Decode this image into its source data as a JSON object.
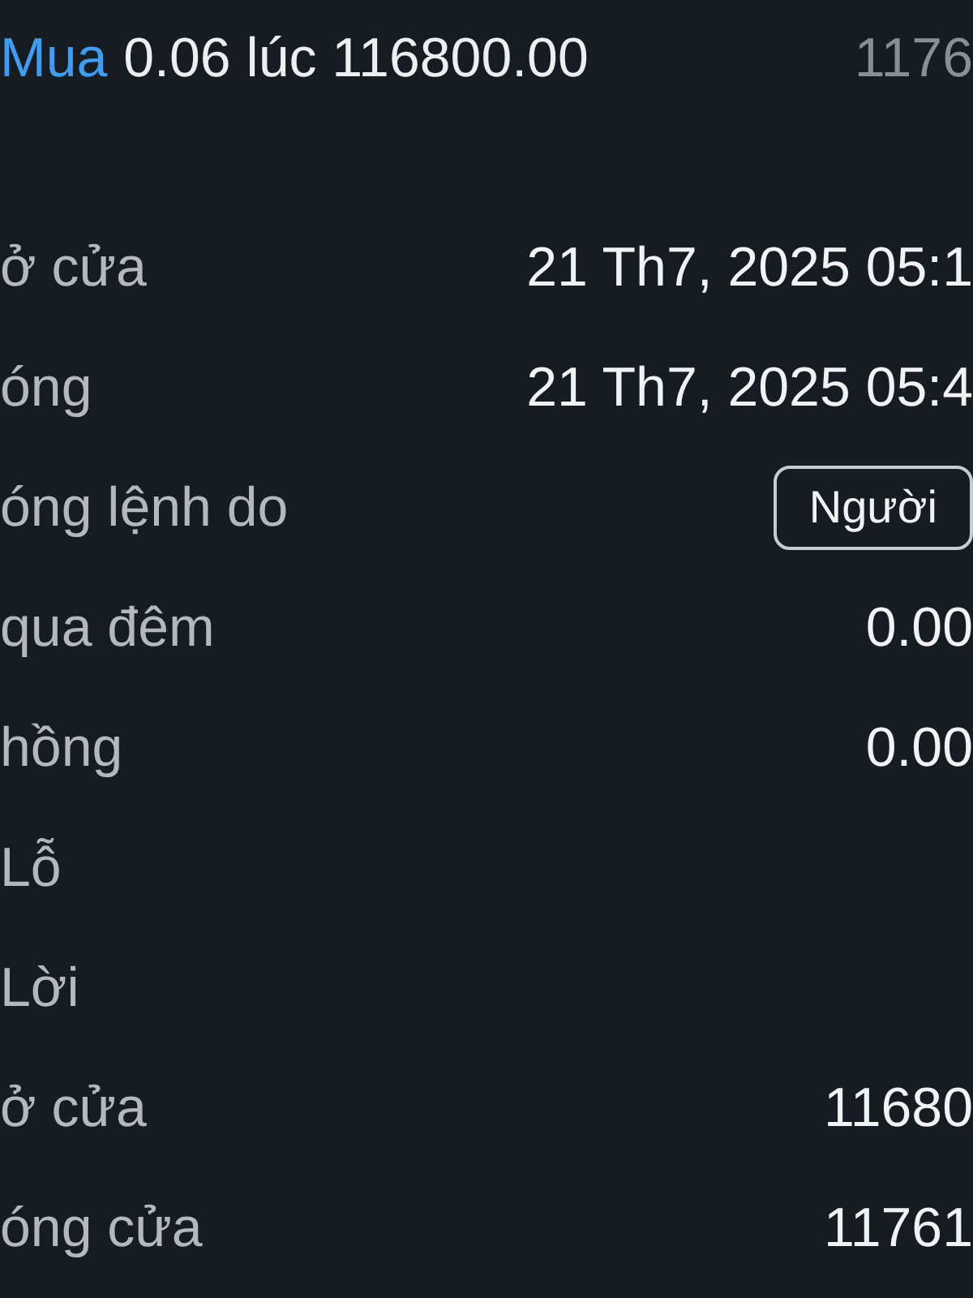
{
  "header": {
    "side": "Mua",
    "detail": "0.06 lúc 116800.00",
    "price": "1176"
  },
  "rows": [
    {
      "kind": "text",
      "label": "ở cửa",
      "value": "21 Th7, 2025 05:1"
    },
    {
      "kind": "text",
      "label": "óng",
      "value": "21 Th7, 2025 05:4"
    },
    {
      "kind": "chip",
      "label": "óng lệnh do",
      "value": "Người"
    },
    {
      "kind": "text",
      "label": "qua đêm",
      "value": "0.00"
    },
    {
      "kind": "text",
      "label": "hồng",
      "value": "0.00"
    },
    {
      "kind": "label",
      "label": "Lỗ"
    },
    {
      "kind": "label",
      "label": "Lời"
    },
    {
      "kind": "text",
      "label": "ở cửa",
      "value": "11680"
    },
    {
      "kind": "text",
      "label": "óng cửa",
      "value": "11761"
    }
  ]
}
